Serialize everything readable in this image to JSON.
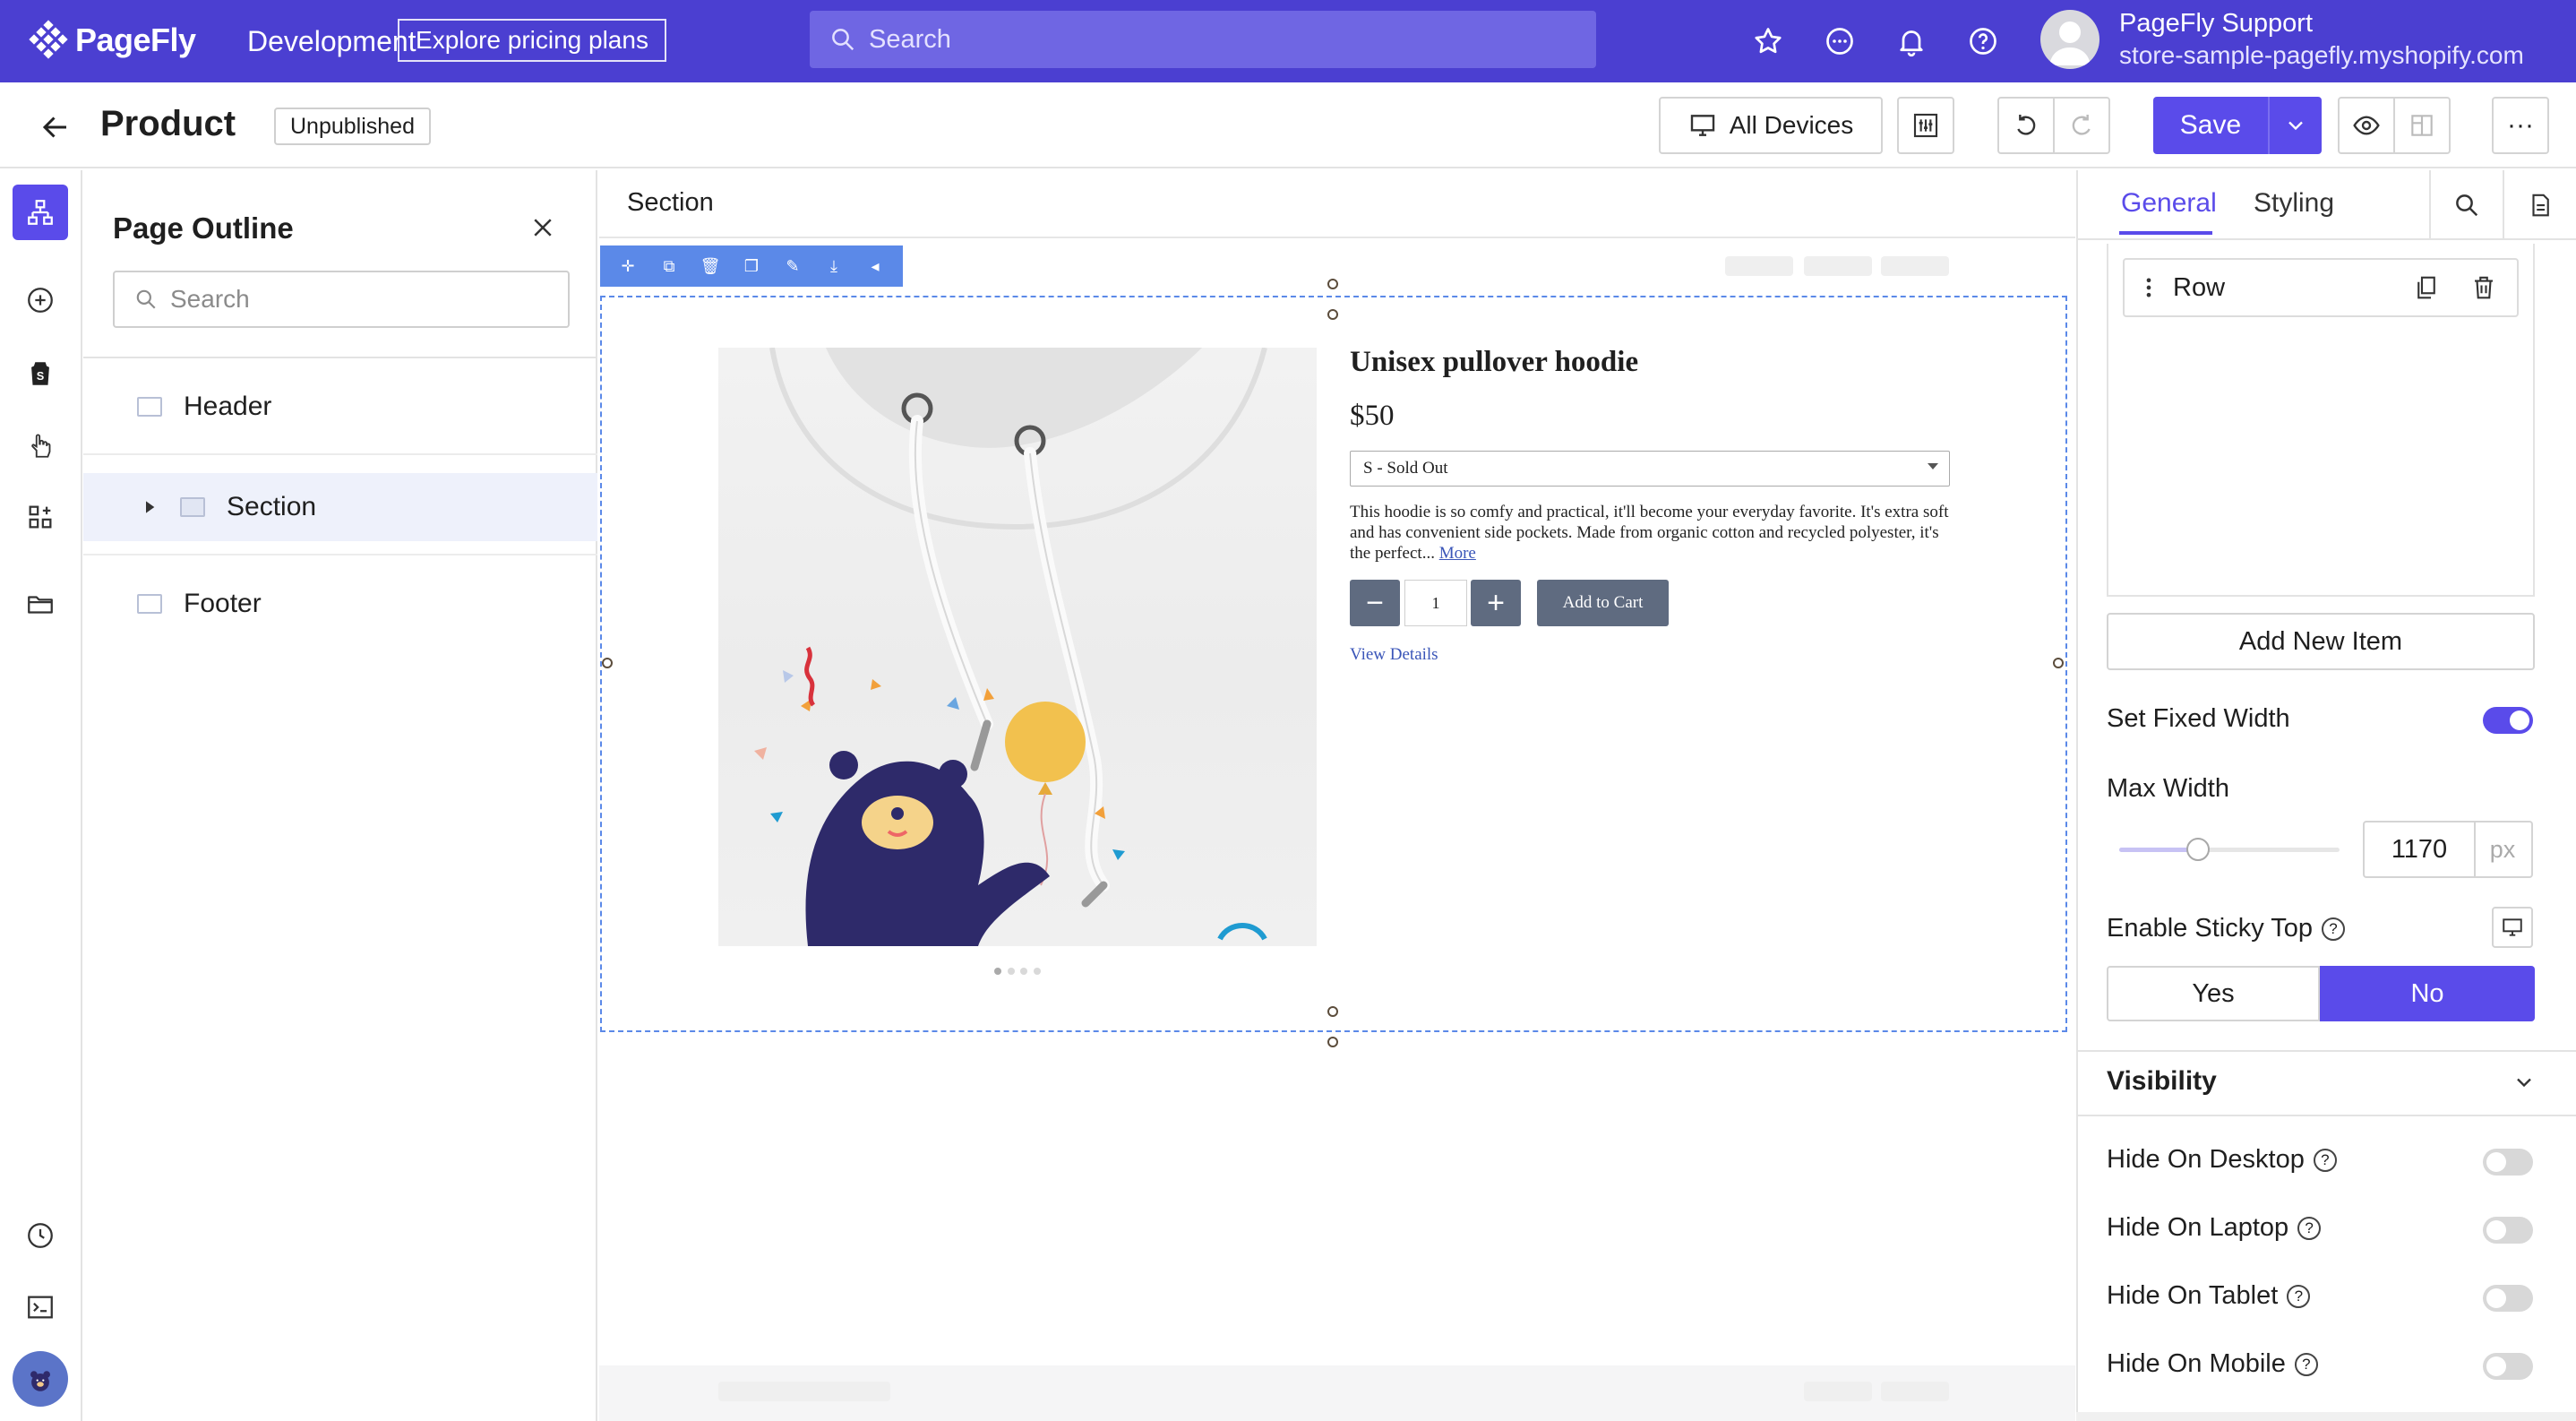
{
  "topbar": {
    "brand": "PageFly",
    "brand_suffix": "Development",
    "pricing_button": "Explore pricing plans",
    "search_placeholder": "Search",
    "user_name": "PageFly Support",
    "user_store": "store-sample-pagefly.myshopify.com",
    "icons": [
      "star-icon",
      "chat-icon",
      "bell-icon",
      "help-icon"
    ]
  },
  "subbar": {
    "title": "Product",
    "status": "Unpublished",
    "devices_label": "All Devices",
    "save_label": "Save",
    "more_label": "···"
  },
  "outline": {
    "title": "Page Outline",
    "search_placeholder": "Search",
    "items": [
      {
        "label": "Header"
      },
      {
        "label": "Section"
      },
      {
        "label": "Footer"
      }
    ]
  },
  "canvas": {
    "section_label": "Section",
    "product": {
      "title": "Unisex pullover hoodie",
      "price": "$50",
      "variant": "S - Sold Out",
      "description": "This hoodie is so comfy and practical, it'll become your everyday favorite. It's extra soft and has convenient side pockets. Made from organic cotton and recycled polyester, it's the perfect...",
      "more_link": "More",
      "qty_minus": "−",
      "qty_value": "1",
      "qty_plus": "+",
      "add_to_cart": "Add to Cart",
      "view_details": "View Details"
    }
  },
  "rpanel": {
    "tabs": [
      {
        "label": "General",
        "active": true
      },
      {
        "label": "Styling",
        "active": false
      }
    ],
    "item_label": "Row",
    "add_item": "Add New Item",
    "fixed_width_label": "Set Fixed Width",
    "fixed_width_on": true,
    "max_width_label": "Max Width",
    "max_width_value": "1170",
    "max_width_unit": "px",
    "sticky_label": "Enable Sticky Top",
    "sticky_yes": "Yes",
    "sticky_no": "No",
    "visibility_title": "Visibility",
    "hide_desktop": "Hide On Desktop",
    "hide_laptop": "Hide On Laptop",
    "hide_tablet": "Hide On Tablet",
    "hide_mobile": "Hide On Mobile"
  },
  "colors": {
    "brand": "#4b3fd1",
    "accent": "#5a4bea",
    "selection": "#5b89e8"
  }
}
